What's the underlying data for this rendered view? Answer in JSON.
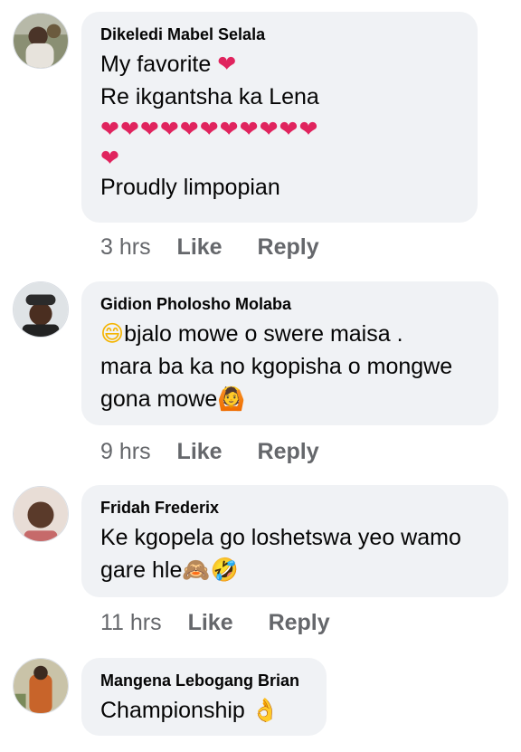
{
  "comments": [
    {
      "author": "Dikeledi Mabel Selala",
      "lines": [
        "My favorite",
        "Re ikgantsha ka Lena",
        "",
        "",
        "Proudly limpopian"
      ],
      "emoji": {
        "favorite_heart": "❤",
        "hearts_row": "❤❤❤❤❤❤❤❤❤❤❤",
        "hearts_row2": "❤"
      },
      "time": "3 hrs",
      "like": "Like",
      "reply": "Reply"
    },
    {
      "author": "Gidion Pholosho Molaba",
      "lines": [
        "bjalo mowe o swere maisa .",
        "mara ba ka no kgopisha o mongwe",
        "gona mowe"
      ],
      "emoji": {
        "grin": "😄",
        "raise_hands": "🙆"
      },
      "time": "9 hrs",
      "like": "Like",
      "reply": "Reply"
    },
    {
      "author": "Fridah Frederix",
      "lines": [
        "Ke kgopela go loshetswa yeo wamo",
        "gare hle"
      ],
      "emoji": {
        "see_no_evil": "🙈",
        "rofl": "🤣"
      },
      "time": "11 hrs",
      "like": "Like",
      "reply": "Reply"
    },
    {
      "author": "Mangena Lebogang Brian",
      "lines": [
        "Championship"
      ],
      "emoji": {
        "ok_hand": "👌"
      },
      "time": "",
      "like": "",
      "reply": ""
    }
  ]
}
